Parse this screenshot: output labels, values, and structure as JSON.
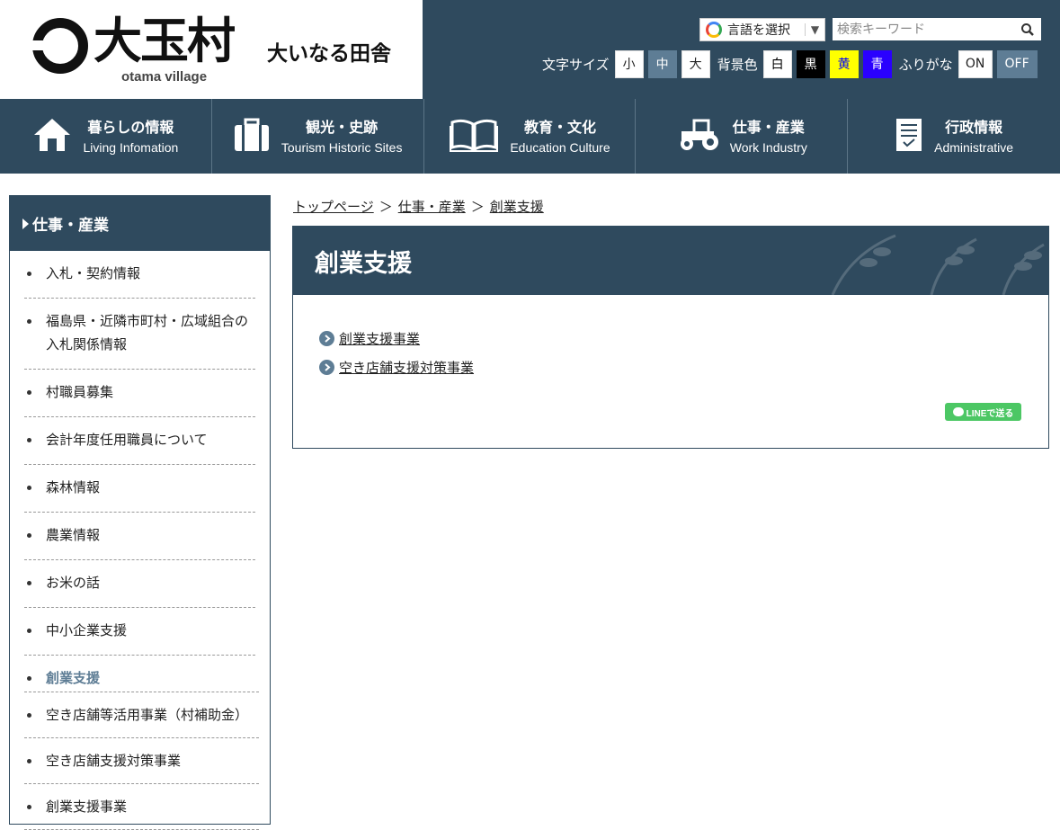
{
  "header": {
    "logo_kanji": "大玉村",
    "logo_roman": "otama village",
    "tagline": "大いなる田舎",
    "language_button": "言語を選択",
    "language_arrow": "▼",
    "search_placeholder": "検索キーワード",
    "font_size_label": "文字サイズ",
    "font_sizes": [
      "小",
      "中",
      "大"
    ],
    "bg_color_label": "背景色",
    "bg_colors": [
      {
        "label": "白",
        "bg": "#ffffff",
        "fg": "#000000"
      },
      {
        "label": "黒",
        "bg": "#000000",
        "fg": "#ffffff"
      },
      {
        "label": "黄",
        "bg": "#ffff00",
        "fg": "#0000ff"
      },
      {
        "label": "青",
        "bg": "#2a00ff",
        "fg": "#ffffff"
      }
    ],
    "furigana_label": "ふりがな",
    "furigana_on": "ON",
    "furigana_off": "OFF"
  },
  "nav": [
    {
      "jp": "暮らしの情報",
      "en": "Living Infomation",
      "icon": "house-icon"
    },
    {
      "jp": "観光・史跡",
      "en": "Tourism Historic Sites",
      "icon": "suitcase-icon"
    },
    {
      "jp": "教育・文化",
      "en": "Education Culture",
      "icon": "book-icon"
    },
    {
      "jp": "仕事・産業",
      "en": "Work Industry",
      "icon": "tractor-icon"
    },
    {
      "jp": "行政情報",
      "en": "Administrative",
      "icon": "document-icon"
    }
  ],
  "sidebar": {
    "title": "仕事・産業",
    "items": [
      "入札・契約情報",
      "福島県・近隣市町村・広域組合の入札関係情報",
      "村職員募集",
      "会計年度任用職員について",
      "森林情報",
      "農業情報",
      "お米の話",
      "中小企業支援"
    ],
    "active": "創業支援",
    "sub_items": [
      "空き店舗等活用事業（村補助金）",
      "空き店舗支援対策事業",
      "創業支援事業"
    ]
  },
  "breadcrumb": [
    "トップページ",
    "仕事・産業",
    "創業支援"
  ],
  "breadcrumb_sep": "＞",
  "main": {
    "title": "創業支援",
    "links": [
      "創業支援事業",
      "空き店舗支援対策事業"
    ],
    "line_button": "LINEで送る"
  },
  "colors": {
    "primary": "#2f4a5e",
    "accent": "#5e7d95",
    "line_green": "#4cc764"
  }
}
